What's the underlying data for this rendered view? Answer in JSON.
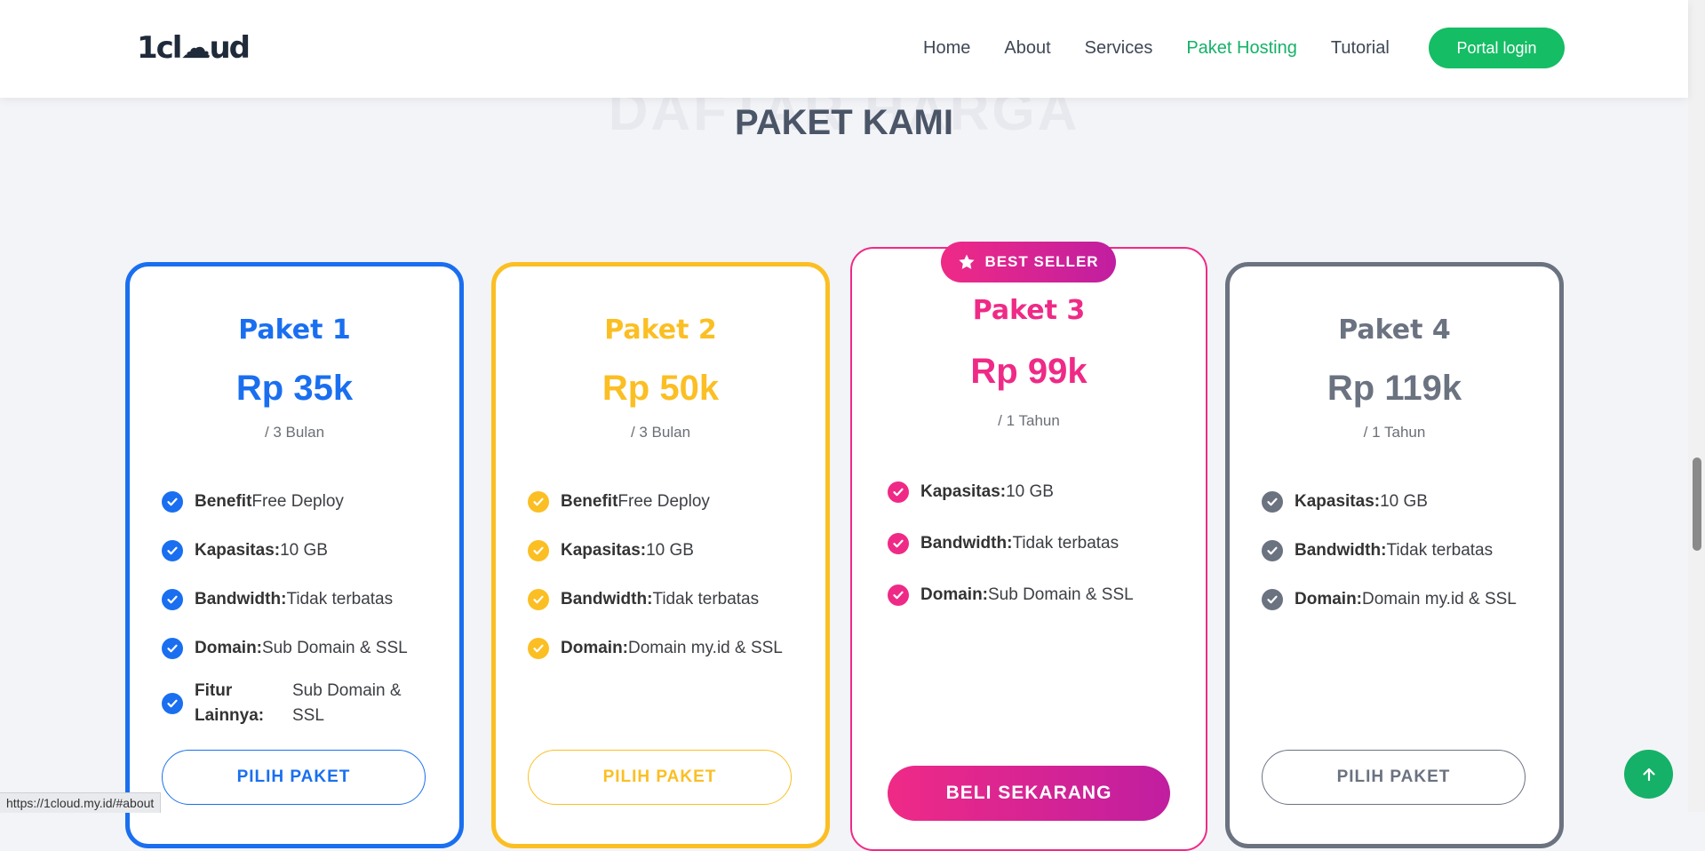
{
  "header": {
    "logo_text": "1cl☁ud",
    "nav": [
      "Home",
      "About",
      "Services",
      "Paket Hosting",
      "Tutorial"
    ],
    "active_nav": "Paket Hosting",
    "portal_label": "Portal login",
    "accent": "#15b168"
  },
  "section": {
    "bg_title": "DAFTAR HARGA",
    "title": "PAKET KAMI"
  },
  "plans": [
    {
      "name": "Paket 1",
      "price": "Rp 35k",
      "period": "/ 3 Bulan",
      "color": "#1a6ff0",
      "features": [
        {
          "label": "Benefit",
          "value": "Free Deploy"
        },
        {
          "label": "Kapasitas:",
          "value": "10 GB"
        },
        {
          "label": "Bandwidth:",
          "value": "Tidak terbatas"
        },
        {
          "label": "Domain:",
          "value": "Sub Domain & SSL"
        },
        {
          "label": "Fitur Lainnya:",
          "value": "Sub Domain & SSL"
        }
      ],
      "button": "PILIH PAKET"
    },
    {
      "name": "Paket 2",
      "price": "Rp 50k",
      "period": "/ 3 Bulan",
      "color": "#fbbf24",
      "features": [
        {
          "label": "Benefit",
          "value": "Free Deploy"
        },
        {
          "label": "Kapasitas:",
          "value": "10 GB"
        },
        {
          "label": "Bandwidth:",
          "value": "Tidak terbatas"
        },
        {
          "label": "Domain:",
          "value": "Domain my.id & SSL"
        }
      ],
      "button": "PILIH PAKET"
    },
    {
      "name": "Paket 3",
      "price": "Rp 99k",
      "period": "/ 1 Tahun",
      "color": "#ef2a86",
      "badge": "BEST SELLER",
      "features": [
        {
          "label": "Kapasitas:",
          "value": "10 GB"
        },
        {
          "label": "Bandwidth:",
          "value": "Tidak terbatas"
        },
        {
          "label": "Domain:",
          "value": "Sub Domain & SSL"
        }
      ],
      "button": "BELI SEKARANG"
    },
    {
      "name": "Paket 4",
      "price": "Rp 119k",
      "period": "/ 1 Tahun",
      "color": "#6b7280",
      "features": [
        {
          "label": "Kapasitas:",
          "value": "10 GB"
        },
        {
          "label": "Bandwidth:",
          "value": "Tidak terbatas"
        },
        {
          "label": "Domain:",
          "value": "Domain my.id & SSL"
        }
      ],
      "button": "PILIH PAKET"
    }
  ],
  "status_url": "https://1cloud.my.id/#about",
  "icons": {
    "check": "check-circle-icon",
    "star": "star-icon",
    "arrow_up": "arrow-up-icon"
  }
}
